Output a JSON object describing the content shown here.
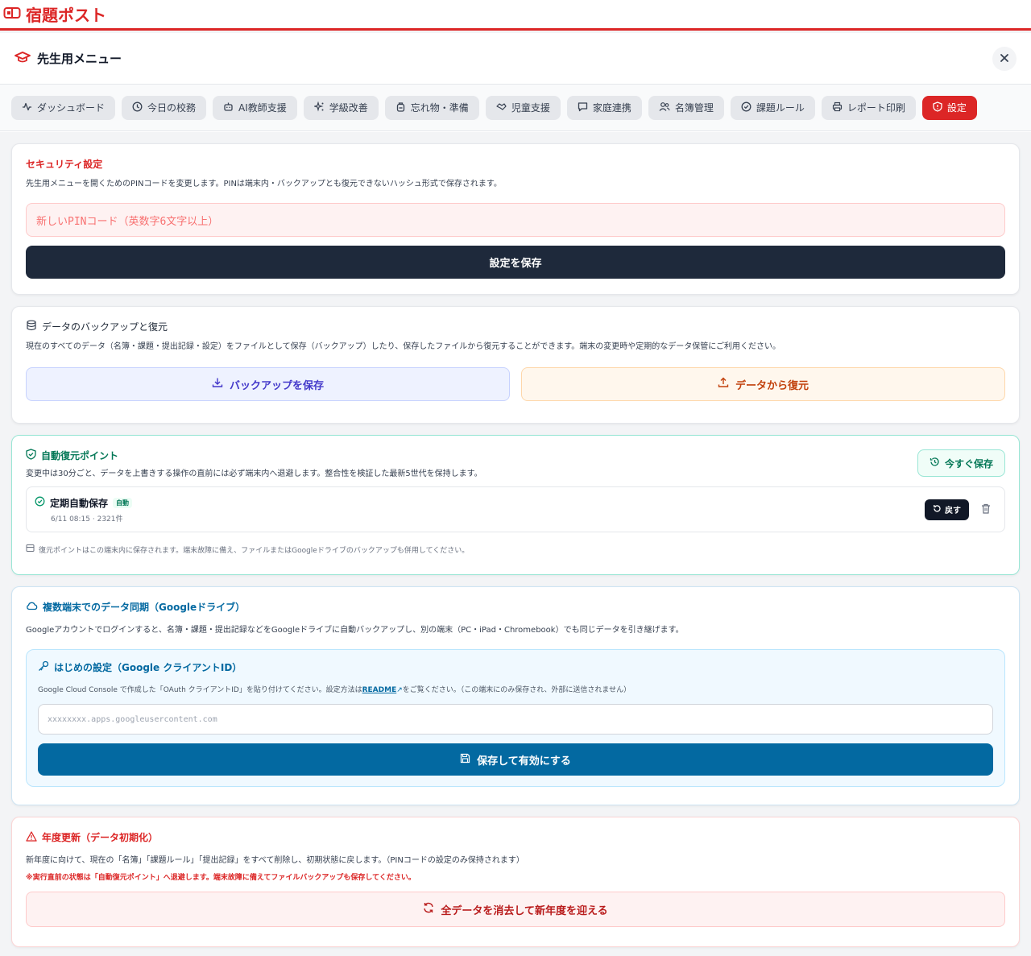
{
  "app": {
    "title": "宿題ポスト",
    "brand_color": "#dc2626"
  },
  "panel": {
    "title": "先生用メニュー"
  },
  "tabs": [
    {
      "label": "ダッシュボード",
      "icon": "activity-icon"
    },
    {
      "label": "今日の校務",
      "icon": "clock-icon"
    },
    {
      "label": "AI教師支援",
      "icon": "robot-icon"
    },
    {
      "label": "学級改善",
      "icon": "sparkles-icon"
    },
    {
      "label": "忘れ物・準備",
      "icon": "backpack-icon"
    },
    {
      "label": "児童支援",
      "icon": "handshake-icon"
    },
    {
      "label": "家庭連携",
      "icon": "message-icon"
    },
    {
      "label": "名簿管理",
      "icon": "users-icon"
    },
    {
      "label": "課題ルール",
      "icon": "check-circle-icon"
    },
    {
      "label": "レポート印刷",
      "icon": "printer-icon"
    },
    {
      "label": "設定",
      "icon": "shield-icon",
      "active": true
    }
  ],
  "security": {
    "title": "セキュリティ設定",
    "desc": "先生用メニューを開くためのPINコードを変更します。PINは端末内・バックアップとも復元できないハッシュ形式で保存されます。",
    "pin_placeholder": "新しいPINコード（英数字6文字以上）",
    "save_label": "設定を保存"
  },
  "backup": {
    "title": "データのバックアップと復元",
    "desc": "現在のすべてのデータ（名簿・課題・提出記録・設定）をファイルとして保存（バックアップ）したり、保存したファイルから復元することができます。端末の変更時や定期的なデータ保管にご利用ください。",
    "backup_label": "バックアップを保存",
    "restore_label": "データから復元"
  },
  "autorestore": {
    "title": "自動復元ポイント",
    "desc": "変更中は30分ごと、データを上書きする操作の直前には必ず端末内へ退避します。整合性を検証した最新5世代を保持します。",
    "save_now_label": "今すぐ保存",
    "snapshot": {
      "name": "定期自動保存",
      "badge": "自動",
      "meta": "6/11 08:15 · 2321件",
      "restore_label": "戻す"
    },
    "note": "復元ポイントはこの端末内に保存されます。端末故障に備え、ファイルまたはGoogleドライブのバックアップも併用してください。"
  },
  "sync": {
    "title": "複数端末でのデータ同期（Googleドライブ）",
    "desc": "Googleアカウントでログインすると、名簿・課題・提出記録などをGoogleドライブに自動バックアップし、別の端末（PC・iPad・Chromebook）でも同じデータを引き継げます。",
    "setup_title": "はじめの設定（Google クライアントID）",
    "setup_desc_pre": "Google Cloud Console で作成した「OAuth クライアントID」を貼り付けてください。設定方法は",
    "readme_label": "README",
    "setup_desc_post": "をご覧ください。（この端末にのみ保存され、外部に送信されません）",
    "client_placeholder": "xxxxxxxx.apps.googleusercontent.com",
    "enable_label": "保存して有効にする"
  },
  "reset": {
    "title": "年度更新（データ初期化）",
    "desc": "新年度に向けて、現在の「名簿」「課題ルール」「提出記録」をすべて削除し、初期状態に戻します。（PINコードの設定のみ保持されます）",
    "warning": "※実行直前の状態は「自動復元ポイント」へ退避します。端末故障に備えてファイルバックアップも保存してください。",
    "reset_label": "全データを消去して新年度を迎える"
  }
}
